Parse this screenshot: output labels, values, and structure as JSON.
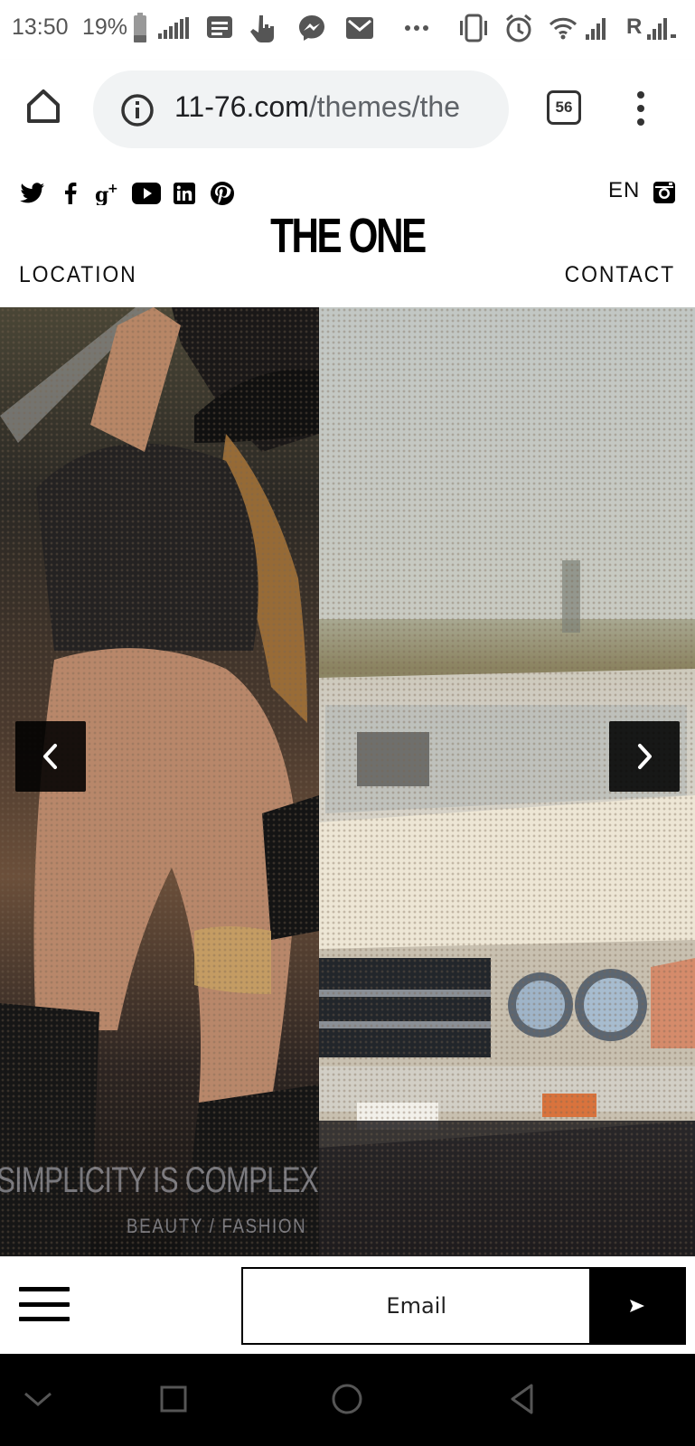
{
  "status_bar": {
    "time": "13:50",
    "battery_percent": "19%",
    "signal_label_r": "R"
  },
  "browser": {
    "url_host": "11-76.com",
    "url_path": "/themes/the",
    "tab_count": "56"
  },
  "site": {
    "logo": "THE ONE",
    "language": "EN",
    "nav_left": "LOCATION",
    "nav_right": "CONTACT",
    "social_icons": [
      "twitter-icon",
      "facebook-icon",
      "google-plus-icon",
      "youtube-icon",
      "linkedin-icon",
      "pinterest-icon"
    ]
  },
  "hero": {
    "caption_title": "SIMPLICITY IS COMPLEX",
    "caption_subtitle": "BEAUTY / FASHION"
  },
  "footer": {
    "email_placeholder": "Email"
  },
  "colors": {
    "accent": "#000000",
    "url_bar_bg": "#f1f3f4"
  }
}
